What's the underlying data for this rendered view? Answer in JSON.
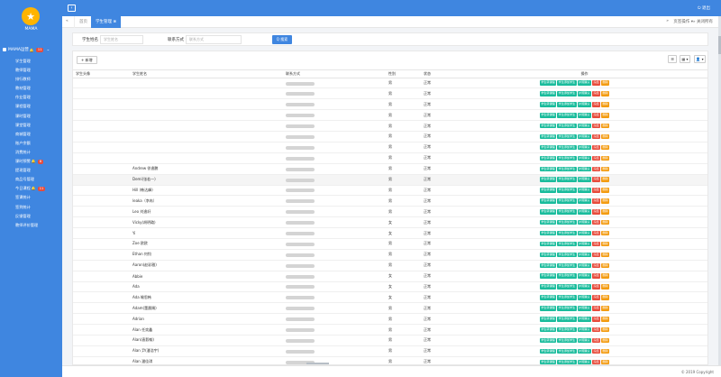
{
  "sidebar": {
    "logo_icon": "star-icon",
    "brand": "MAMA",
    "section": {
      "label": "MAMA运营",
      "badge": "11",
      "bell": "🔔"
    },
    "items": [
      {
        "label": "学生管理",
        "active": true
      },
      {
        "label": "教师管理"
      },
      {
        "label": "排行教师"
      },
      {
        "label": "教材管理"
      },
      {
        "label": "作业管理"
      },
      {
        "label": "课程管理"
      },
      {
        "label": "课时管理"
      },
      {
        "label": "课堂管理"
      },
      {
        "label": "商城管理"
      },
      {
        "label": "账户余额"
      },
      {
        "label": "消费统计"
      },
      {
        "label": "课时预警",
        "badge": "8",
        "bell": true
      },
      {
        "label": "提现管理"
      },
      {
        "label": "商品号管理"
      },
      {
        "label": "今日课程",
        "badge": "11",
        "bell": true
      },
      {
        "label": "签课统计"
      },
      {
        "label": "签到统计"
      },
      {
        "label": "反馈管理"
      },
      {
        "label": "教师评价管理"
      }
    ]
  },
  "topbar": {
    "toggle": "‹",
    "logout": "退出",
    "logout_icon": "power-icon"
  },
  "tabs": {
    "nav_prev": "«",
    "nav_next": "»",
    "home": "首页",
    "active": "学生管理 ⊗",
    "ops": "页签操作 ▾",
    "close_all": "» 关闭所有"
  },
  "search": {
    "name_label": "学生姓名",
    "name_placeholder": "学生姓名",
    "contact_label": "联系方式",
    "contact_placeholder": "联系方式",
    "button": "Q 搜索"
  },
  "toolbar": {
    "add": "+ 新增",
    "tool1": "☰",
    "tool2": "▦ ▾",
    "tool3": "👤 ▾"
  },
  "table": {
    "headers": [
      "学生头像",
      "学生姓名",
      "联系方式",
      "性别",
      "状态",
      "操作"
    ],
    "actions": [
      "学生转课程",
      "学生添加学生",
      "护照确认",
      "冻结",
      "删除"
    ],
    "rows": [
      {
        "name": "",
        "gender": "男",
        "status": "正常"
      },
      {
        "name": "",
        "gender": "男",
        "status": "正常"
      },
      {
        "name": "",
        "gender": "男",
        "status": "正常"
      },
      {
        "name": "",
        "gender": "男",
        "status": "正常"
      },
      {
        "name": "",
        "gender": "男",
        "status": "正常"
      },
      {
        "name": "",
        "gender": "男",
        "status": "正常"
      },
      {
        "name": "",
        "gender": "男",
        "status": "正常"
      },
      {
        "name": "",
        "gender": "男",
        "status": "正常"
      },
      {
        "name": "Andrew 徐逸鹏",
        "gender": "男",
        "status": "正常"
      },
      {
        "name": "Demi(张若一)",
        "gender": "男",
        "status": "正常",
        "hl": true
      },
      {
        "name": "Hill (韩达峰)",
        "gender": "男",
        "status": "正常"
      },
      {
        "name": "leaka（李冉）",
        "gender": "男",
        "status": "正常"
      },
      {
        "name": "Leo 刘逸轩",
        "gender": "男",
        "status": "正常"
      },
      {
        "name": "Vicky(胡明璐)",
        "gender": "女",
        "status": "正常"
      },
      {
        "name": "Yi",
        "gender": "女",
        "status": "正常"
      },
      {
        "name": "Zoe 欧欧",
        "gender": "男",
        "status": "正常"
      },
      {
        "name": "Ethan 何钧",
        "gender": "男",
        "status": "正常"
      },
      {
        "name": "Aaron(赵彩雅)",
        "gender": "男",
        "status": "正常"
      },
      {
        "name": "Abbie",
        "gender": "女",
        "status": "正常"
      },
      {
        "name": "Ada",
        "gender": "女",
        "status": "正常"
      },
      {
        "name": "Ada 喻思韩",
        "gender": "女",
        "status": "正常"
      },
      {
        "name": "Adam(董晨赐)",
        "gender": "男",
        "status": "正常"
      },
      {
        "name": "Adrian",
        "gender": "男",
        "status": "正常"
      },
      {
        "name": "Alan 任奕鑫",
        "gender": "男",
        "status": "正常"
      },
      {
        "name": "Alan(袁毅翰)",
        "gender": "男",
        "status": "正常"
      },
      {
        "name": "Alan 尹(潘浩宇)",
        "gender": "男",
        "status": "正常"
      },
      {
        "name": "Alan 潘佳琪",
        "gender": "男",
        "status": "正常"
      }
    ]
  },
  "footer": {
    "copyright": "© 2019 Copyright"
  }
}
